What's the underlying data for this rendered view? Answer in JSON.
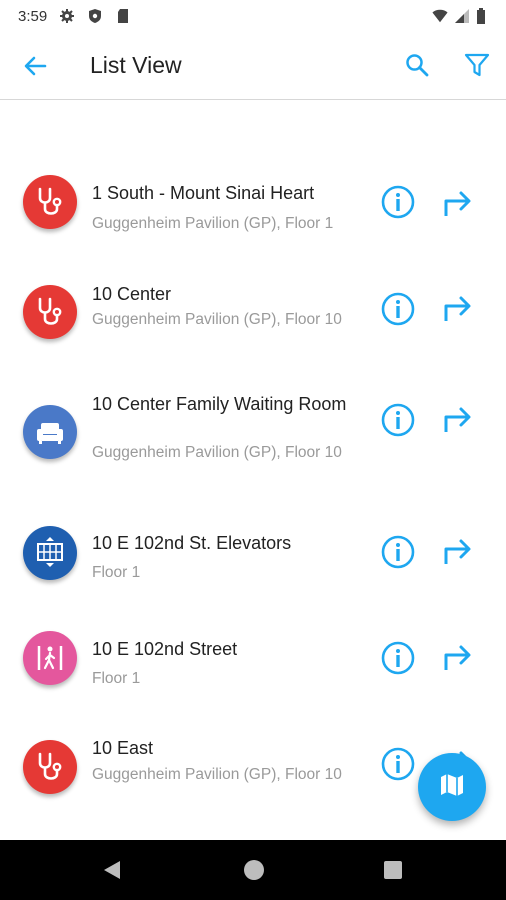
{
  "status_bar": {
    "time": "3:59",
    "icons": [
      "gear-icon",
      "shield-icon",
      "sd-card-icon",
      "wifi-icon",
      "signal-icon",
      "battery-icon"
    ]
  },
  "toolbar": {
    "title": "List View",
    "back_icon": "arrow-left-icon",
    "search_icon": "search-icon",
    "filter_icon": "filter-icon"
  },
  "colors": {
    "accent": "#1ea7f0",
    "doctor": "#e53935",
    "waiting": "#4a79c8",
    "elevator": "#1f5fb0",
    "pedestrian": "#e4579d"
  },
  "list": [
    {
      "title": "1 South - Mount Sinai Heart",
      "subtitle": "Guggenheim Pavilion (GP), Floor 1",
      "icon": "stethoscope-icon"
    },
    {
      "title": "10 Center",
      "subtitle": "Guggenheim Pavilion (GP), Floor 10",
      "icon": "stethoscope-icon"
    },
    {
      "title": "10 Center Family Waiting Room",
      "subtitle": "Guggenheim Pavilion (GP), Floor 10",
      "icon": "sofa-icon"
    },
    {
      "title": "10 E 102nd St. Elevators",
      "subtitle": "Floor 1",
      "icon": "elevator-icon"
    },
    {
      "title": "10 E 102nd Street",
      "subtitle": "Floor 1",
      "icon": "pedestrian-icon"
    },
    {
      "title": "10 East",
      "subtitle": "Guggenheim Pavilion (GP), Floor 10",
      "icon": "stethoscope-icon"
    }
  ],
  "fab": {
    "icon": "map-icon"
  },
  "nav_bar": {
    "icons": [
      "nav-back-icon",
      "nav-home-icon",
      "nav-recents-icon"
    ]
  }
}
